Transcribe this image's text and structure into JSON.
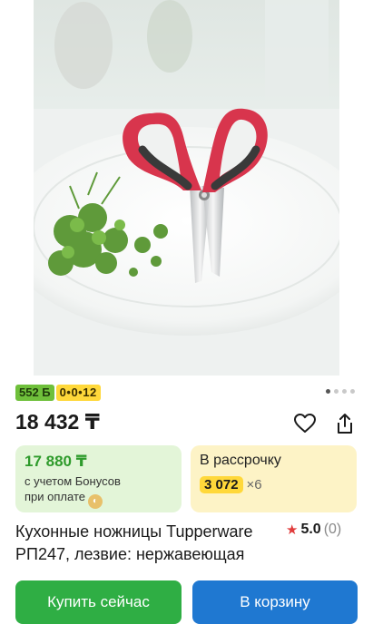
{
  "badges": {
    "bonus": "552 Б",
    "installment": "0•0•12"
  },
  "price": "18 432 ₸",
  "bonus_card": {
    "price": "17 880 ₸",
    "note_line1": "с учетом Бонусов",
    "note_line2": "при оплате"
  },
  "installment_card": {
    "title": "В рассрочку",
    "amount": "3 072",
    "months": "×6"
  },
  "product": {
    "title": "Кухонные ножницы Tupperware РП247, лезвие: нержавеющая",
    "rating": "5.0",
    "reviews": "(0)"
  },
  "buttons": {
    "buy": "Купить сейчас",
    "cart": "В корзину"
  },
  "colors": {
    "bonus_green": "#6fc03b",
    "installment_yellow": "#ffd83a",
    "buy_button": "#2fae44",
    "cart_button": "#1f78d1",
    "rating_star": "#e03b3b"
  },
  "icons": [
    "heart-icon",
    "share-icon",
    "star-icon",
    "coin-icon"
  ]
}
